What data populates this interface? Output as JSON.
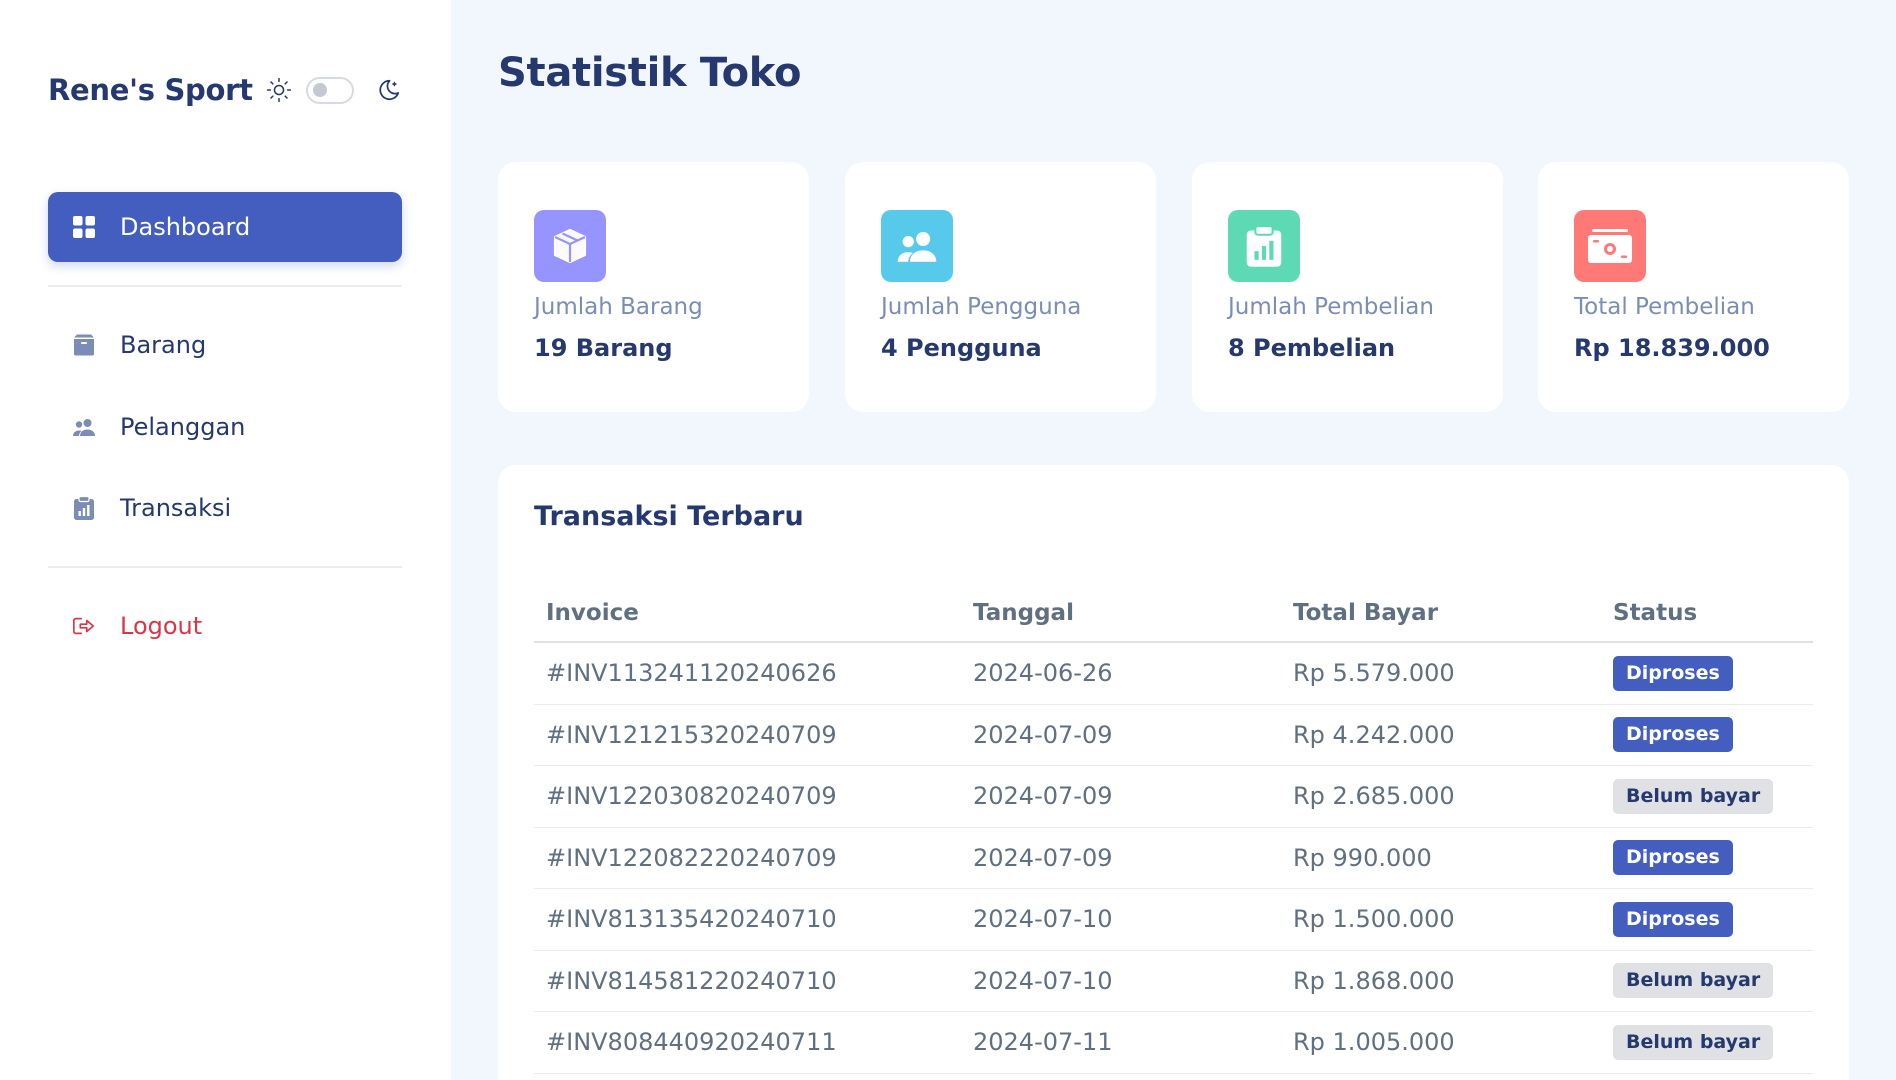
{
  "sidebar": {
    "brand": "Rene's Sport",
    "menu": [
      {
        "label": "Dashboard",
        "icon": "grid-icon",
        "active": true
      },
      {
        "label": "Barang",
        "icon": "box-icon"
      },
      {
        "label": "Pelanggan",
        "icon": "users-icon"
      },
      {
        "label": "Transaksi",
        "icon": "clipboard-data-icon"
      }
    ],
    "logout": {
      "label": "Logout",
      "icon": "logout-icon",
      "color": "#dc3545"
    }
  },
  "page": {
    "title": "Statistik Toko"
  },
  "stats": [
    {
      "label": "Jumlah Barang",
      "value": "19 Barang",
      "icon": "box-icon",
      "color": "#9694ff"
    },
    {
      "label": "Jumlah Pengguna",
      "value": "4 Pengguna",
      "icon": "users-icon",
      "color": "#57caeb"
    },
    {
      "label": "Jumlah Pembelian",
      "value": "8 Pembelian",
      "icon": "clipboard-data-icon",
      "color": "#5ddab4"
    },
    {
      "label": "Total Pembelian",
      "value": "Rp 18.839.000",
      "icon": "cash-icon",
      "color": "#ff7976"
    }
  ],
  "transactions": {
    "title": "Transaksi Terbaru",
    "columns": [
      "Invoice",
      "Tanggal",
      "Total Bayar",
      "Status"
    ],
    "rows": [
      {
        "invoice": "#INV113241120240626",
        "date": "2024-06-26",
        "total": "Rp 5.579.000",
        "status": "Diproses"
      },
      {
        "invoice": "#INV121215320240709",
        "date": "2024-07-09",
        "total": "Rp 4.242.000",
        "status": "Diproses"
      },
      {
        "invoice": "#INV122030820240709",
        "date": "2024-07-09",
        "total": "Rp 2.685.000",
        "status": "Belum bayar"
      },
      {
        "invoice": "#INV122082220240709",
        "date": "2024-07-09",
        "total": "Rp 990.000",
        "status": "Diproses"
      },
      {
        "invoice": "#INV813135420240710",
        "date": "2024-07-10",
        "total": "Rp 1.500.000",
        "status": "Diproses"
      },
      {
        "invoice": "#INV814581220240710",
        "date": "2024-07-10",
        "total": "Rp 1.868.000",
        "status": "Belum bayar"
      },
      {
        "invoice": "#INV808440920240711",
        "date": "2024-07-11",
        "total": "Rp 1.005.000",
        "status": "Belum bayar"
      }
    ]
  },
  "colors": {
    "primary": "#435ebe",
    "background": "#f2f6fd",
    "text": "#25396f",
    "muted": "#607080"
  }
}
